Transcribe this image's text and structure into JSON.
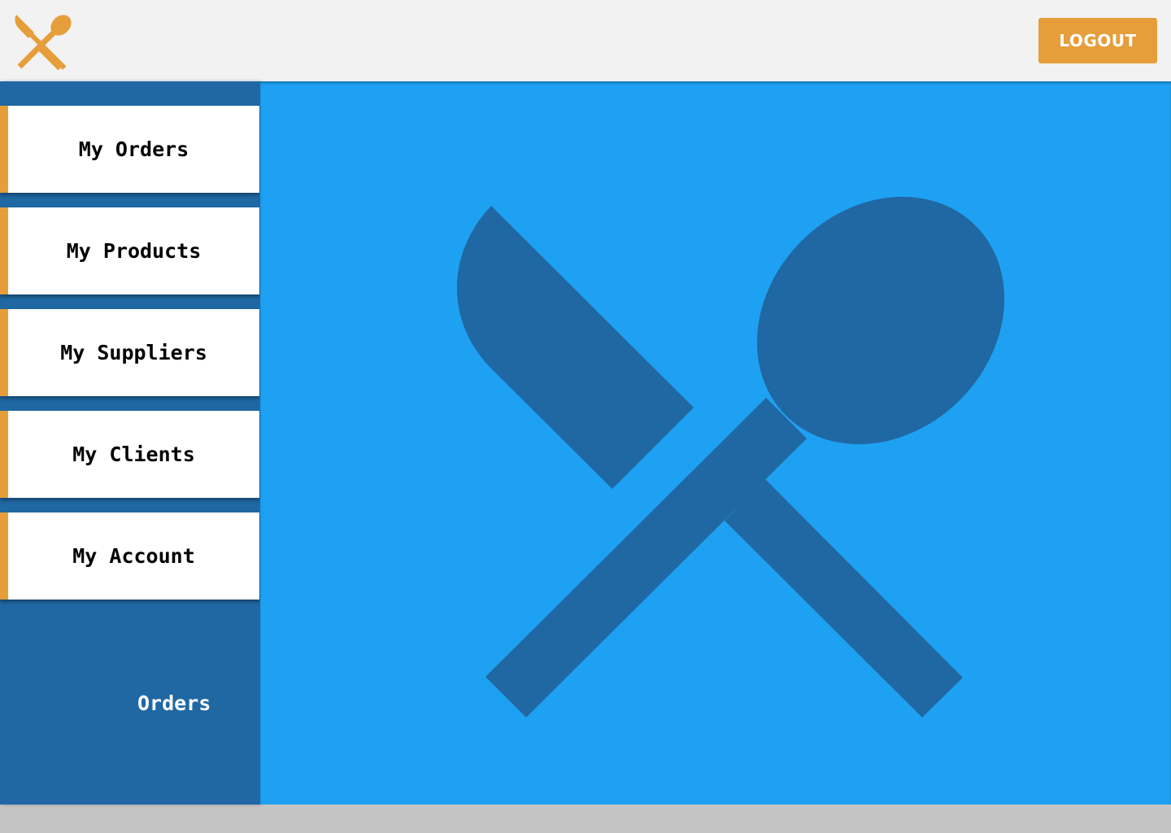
{
  "header": {
    "logo_icon": "fork-knife-spoon-icon",
    "logout_label": "LOGOUT"
  },
  "sidebar": {
    "items": [
      {
        "label": "My Orders"
      },
      {
        "label": "My Products"
      },
      {
        "label": "My Suppliers"
      },
      {
        "label": "My Clients"
      },
      {
        "label": "My Account"
      }
    ],
    "section_label": "Orders"
  },
  "main": {
    "hero_icon": "knife-spoon-icon"
  },
  "colors": {
    "accent": "#e69e3b",
    "sidebar": "#2068a3",
    "main": "#1ea1f2",
    "header": "#f2f2f2"
  }
}
